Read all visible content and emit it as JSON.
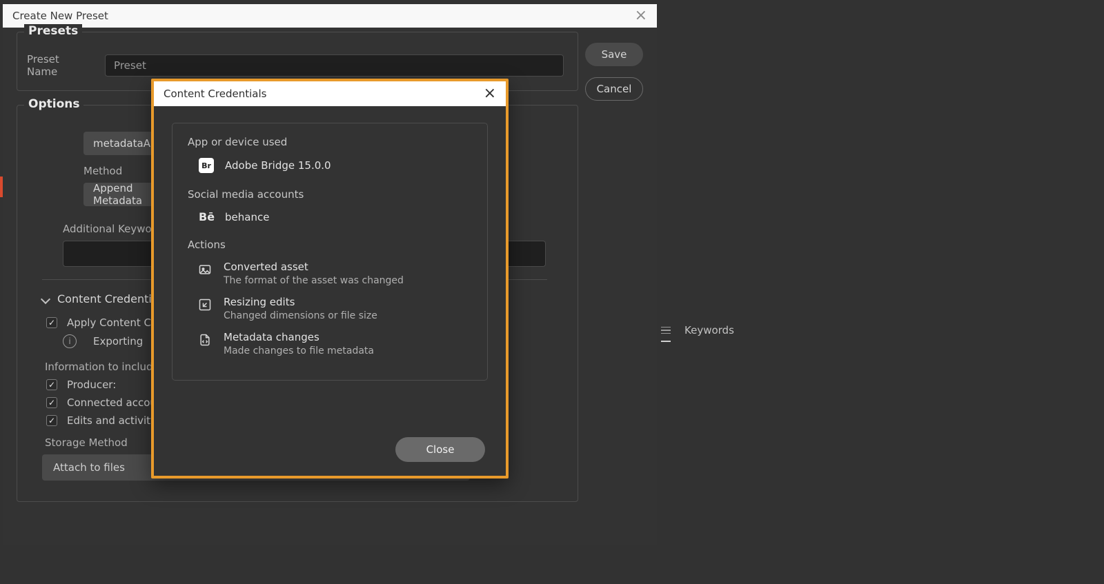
{
  "preset_dialog": {
    "title": "Create New Preset",
    "save": "Save",
    "cancel": "Cancel",
    "presets_legend": "Presets",
    "preset_name_label": "Preset Name",
    "preset_name_value": "Preset",
    "options_legend": "Options",
    "chip_metadata": "metadataAppend",
    "method_label": "Method",
    "chip_append": "Append Metadata",
    "additional_keywords_label": "Additional Keywords",
    "cc_section": "Content Credentials",
    "apply_cc": "Apply Content Credentials",
    "exporting_line": "Exporting",
    "info_to_include": "Information to include",
    "producer": "Producer:",
    "connected_acc": "Connected accounts",
    "edits_activity": "Edits and activity",
    "storage_method": "Storage Method",
    "storage_value": "Attach to files"
  },
  "right_panel": {
    "tab": "Keywords"
  },
  "cc_dialog": {
    "title": "Content Credentials",
    "app_section": "App or device used",
    "app_badge": "Br",
    "app_name": "Adobe Bridge 15.0.0",
    "social_section": "Social media accounts",
    "be_badge": "Bē",
    "social_name": "behance",
    "actions_section": "Actions",
    "actions": [
      {
        "title": "Converted asset",
        "desc": "The format of the asset was changed"
      },
      {
        "title": "Resizing edits",
        "desc": "Changed dimensions or file size"
      },
      {
        "title": "Metadata changes",
        "desc": "Made changes to file metadata"
      }
    ],
    "close": "Close"
  }
}
